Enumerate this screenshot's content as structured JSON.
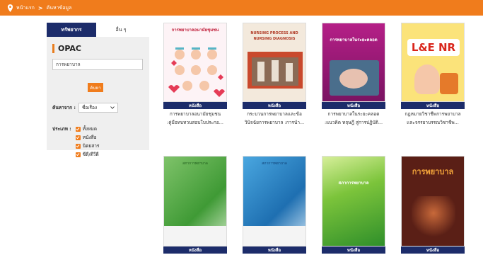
{
  "breadcrumb": {
    "home": "หน้าแรก",
    "separator": ">",
    "current": "ค้นหาข้อมูล"
  },
  "sidebar": {
    "tabs": [
      {
        "label": "ทรัพยากร"
      },
      {
        "label": "อื่น ๆ"
      }
    ],
    "opac_title": "OPAC",
    "search_value": "การพยาบาล",
    "search_button": "ค้นหา",
    "search_by_label": "ค้นหาจาก :",
    "search_by_value": "ชื่อเรื่อง",
    "type_label": "ประเภท :",
    "types": [
      "ทั้งหมด",
      "หนังสือ",
      "นิตยสาร",
      "ซีดี/ดีวีดี"
    ]
  },
  "books": [
    {
      "cover_title": "การพยาบาลอนามัยชุมชน",
      "badge": "หนังสือ",
      "line1": "การพยาบาลอนามัยชุมชน",
      "line2": ":คู่มือทบทวนสอบใบประกอ...",
      "accent": "#d63a55"
    },
    {
      "cover_title": "NURSING PROCESS AND NURSING DIAGNOSIS",
      "badge": "หนังสือ",
      "line1": "กระบวนการพยาบาลและข้อ",
      "line2": "วินิจฉัยการพยาบาล :การนำ...",
      "accent": "#c9492d"
    },
    {
      "cover_title": "การพยาบาลในระยะคลอด",
      "badge": "หนังสือ",
      "line1": "การพยาบาลในระยะคลอด",
      "line2": ":แนวคิด ทฤษฎี สู่การปฏิบัติ...",
      "accent": "#a0197a"
    },
    {
      "cover_title": "L&E NR",
      "badge": "หนังสือ",
      "line1": "กฎหมายวิชาชีพการพยาบาล",
      "line2": "และจรรยาบรรณวิชาชีพ...",
      "accent": "#f2c300"
    },
    {
      "cover_title": "สภาการพยาบาล",
      "badge": "หนังสือ",
      "line1": "",
      "line2": "",
      "accent": "#5aab3c"
    },
    {
      "cover_title": "สภาการพยาบาล",
      "badge": "หนังสือ",
      "line1": "",
      "line2": "",
      "accent": "#2a7fc2"
    },
    {
      "cover_title": "สภาการพยาบาล",
      "badge": "หนังสือ",
      "line1": "",
      "line2": "",
      "accent": "#3a9b2b"
    },
    {
      "cover_title": "การพยาบาล",
      "badge": "หนังสือ",
      "line1": "",
      "line2": "",
      "accent": "#f08a1c"
    }
  ],
  "colors": {
    "brand_orange": "#f07c1c",
    "navy": "#1c2c6a"
  }
}
